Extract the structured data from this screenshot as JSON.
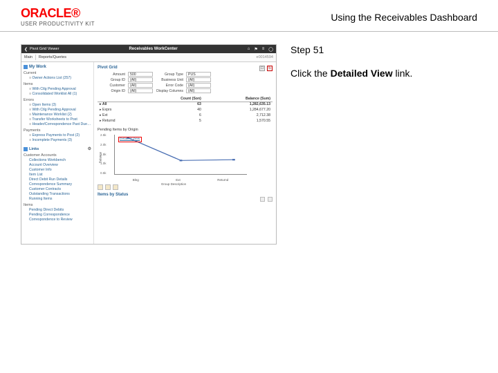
{
  "header": {
    "brand": "ORACLE",
    "brand_reg": "®",
    "brand_sub": "USER PRODUCTIVITY KIT",
    "title": "Using the Receivables Dashboard"
  },
  "instructions": {
    "step_label": "Step 51",
    "text_pre": "Click the ",
    "text_bold": "Detailed View",
    "text_post": " link."
  },
  "screenshot": {
    "titlebar": {
      "back": "❮",
      "left_title": "Pivot Grid Viewer",
      "center": "Receivables WorkCenter",
      "icons": {
        "home": "⌂",
        "flag": "⚑",
        "menu": "≡",
        "avatar": "◯"
      }
    },
    "subbar": {
      "tab1": "Main",
      "tab2": "Reports/Queries",
      "user": "e0014594"
    },
    "sidebar": {
      "my_work_label": "My Work",
      "groups": [
        {
          "label": "Current",
          "items": [
            "Owner Actions List (257)"
          ]
        },
        {
          "label": "Items",
          "items": [
            "With Ctlg Pending Approval",
            "Consolidated Worklist All (1)"
          ]
        },
        {
          "label": "Errors",
          "items": [
            "Open Items (3)",
            "With Ctlg Pending Approval",
            "Maintenance Worklist (2)",
            "Transfer Worksheets to Post",
            "Header/Correspondence Past Due (1)"
          ]
        },
        {
          "label": "Payments",
          "items": [
            "Express Payments to Post (2)",
            "Incomplete Payments (3)"
          ]
        }
      ],
      "links_label": "Links",
      "links_gear": "⚙",
      "link_groups": [
        {
          "label": "Customer Accounts",
          "items": [
            "Collections Workbench",
            "Account Overview",
            "Customer Info",
            "Item List",
            "Direct Debit Run Details",
            "Correspondence Summary",
            "Customer Contracts",
            "Outstanding Transactions",
            "Running Items"
          ]
        },
        {
          "label": "Items",
          "items": [
            "Pending Direct Debits",
            "Pending Correspondence",
            "Correspondence to Review"
          ]
        }
      ]
    },
    "content": {
      "panel_title": "Pivot Grid",
      "icons": {
        "pop": "☐",
        "refresh": "↻"
      },
      "filters": [
        {
          "label": "Amount",
          "value": "500"
        },
        {
          "label": "Group Type",
          "value": "PUS"
        },
        {
          "label": "Group ID",
          "value": "(All)"
        },
        {
          "label": "Business Unit",
          "value": "(All)"
        },
        {
          "label": "Customer",
          "value": "(All)"
        },
        {
          "label": "Error Code",
          "value": "(All)"
        },
        {
          "label": "Origin ID",
          "value": "(All)"
        },
        {
          "label": "Display Columns",
          "value": "(All)"
        }
      ],
      "table": {
        "col1": "Count (Son)",
        "col2": "Balance (Sum)",
        "rows": [
          {
            "label": "All",
            "count": "63",
            "balance": "1,282,635.13",
            "bold": true
          },
          {
            "label": "Exprs",
            "count": "40",
            "balance": "1,284,677.20"
          },
          {
            "label": "Ext",
            "count": "6",
            "balance": "2,712.38"
          },
          {
            "label": "Returnd",
            "count": "5",
            "balance": "1,570.55"
          }
        ]
      },
      "chart": {
        "title": "Pending Items by Origin",
        "y_ticks": [
          "2.5k",
          "2.0k",
          "1.5k",
          "1.0k",
          "0.5k"
        ],
        "y_label": "Balance",
        "x_label": "Group Description",
        "detailed_view_label": "Detailed View"
      },
      "status_title": "Items by Status"
    }
  },
  "chart_data": {
    "type": "line",
    "categories": [
      "Blng",
      "Ext",
      "Returnd"
    ],
    "values": [
      2400,
      900,
      950
    ],
    "title": "Pending Items by Origin",
    "xlabel": "Group Description",
    "ylabel": "Balance",
    "ylim": [
      0,
      2500
    ]
  }
}
